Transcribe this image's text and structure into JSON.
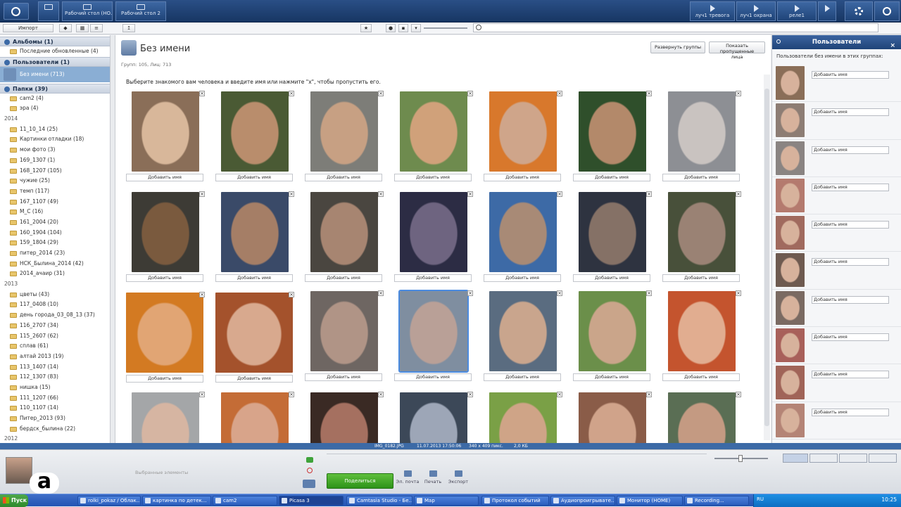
{
  "topbar": {
    "desktop1": "Рабочий стол (НО...",
    "desktop2": "Рабочий стол 2",
    "right_buttons": [
      "луч1 тревога",
      "луч1 охрана",
      "реле1"
    ]
  },
  "toolbar": {
    "import_label": "Импорт"
  },
  "sidebar": {
    "albums": "Альбомы (1)",
    "recent": "Последние обновленные (4)",
    "people": "Пользователи (1)",
    "noname": "Без имени (713)",
    "folders": "Папки (39)",
    "top_folders": [
      "cam2 (4)",
      "эра (4)"
    ],
    "year_2014": "2014",
    "folders_2014": [
      "11_10_14 (25)",
      "Картинки отладки (18)",
      "мои фото (3)",
      "169_1307 (1)",
      "168_1207 (105)",
      "чужие (25)",
      "темп (117)",
      "167_1107 (49)",
      "М_С (16)",
      "161_2004 (20)",
      "160_1904 (104)",
      "159_1804 (29)",
      "питер_2014 (23)",
      "НСК_Былина_2014 (42)",
      "2014_ачаир (31)"
    ],
    "year_2013": "2013",
    "folders_2013": [
      "цветы (43)",
      "117_0408 (10)",
      "день города_03_08_13 (37)",
      "116_2707 (34)",
      "115_2607 (62)",
      "сплав (61)",
      "алтай 2013 (19)",
      "113_1407 (14)",
      "112_1307 (83)",
      "нишка (15)",
      "111_1207 (66)",
      "110_1107 (14)",
      "Питер_2013 (93)",
      "бердск_былина (22)"
    ],
    "year_2012": "2012"
  },
  "main": {
    "title": "Без имени",
    "stats": "Групп: 105, Лиц: 713",
    "expand_button": "Развернуть группы",
    "show_skipped_line1": "Показать пропущенные",
    "show_skipped_line2": "лица",
    "instruction": "Выберите знакомого вам человека и введите имя или нажмите \"x\", чтобы пропустить его.",
    "add_name": "Добавить имя",
    "close_glyph": "×"
  },
  "faces": [
    {
      "c1": "#d8b79a",
      "c2": "#8a6e58"
    },
    {
      "c1": "#b98d6c",
      "c2": "#4a5a34"
    },
    {
      "c1": "#c7a083",
      "c2": "#7d7d78"
    },
    {
      "c1": "#d0a17a",
      "c2": "#6e8b4e"
    },
    {
      "c1": "#cfa58a",
      "c2": "#d8782c"
    },
    {
      "c1": "#b3896a",
      "c2": "#2f4f2b"
    },
    {
      "c1": "#c9c3c0",
      "c2": "#8d8f94"
    },
    {
      "c1": "#7a5a3e",
      "c2": "#3d3b35"
    },
    {
      "c1": "#a57e66",
      "c2": "#3a4a68"
    },
    {
      "c1": "#a78571",
      "c2": "#4a4640"
    },
    {
      "c1": "#6e6480",
      "c2": "#2c2c44"
    },
    {
      "c1": "#a88a76",
      "c2": "#3d6aa6"
    },
    {
      "c1": "#857166",
      "c2": "#2e3340"
    },
    {
      "c1": "#9a8274",
      "c2": "#48503a"
    },
    {
      "c1": "#e1a574",
      "c2": "#d37a22"
    },
    {
      "c1": "#d8a98e",
      "c2": "#a4522c"
    },
    {
      "c1": "#b09486",
      "c2": "#6e6662"
    },
    {
      "c1": "#b9a097",
      "c2": "#7f8ea0"
    },
    {
      "c1": "#c9a58d",
      "c2": "#5a6c80"
    },
    {
      "c1": "#caa58a",
      "c2": "#6b8f4a"
    },
    {
      "c1": "#e1ad90",
      "c2": "#c4542e"
    },
    {
      "c1": "#d6b5a2",
      "c2": "#a4a6a8"
    },
    {
      "c1": "#d8a48a",
      "c2": "#c46c36"
    },
    {
      "c1": "#a57060",
      "c2": "#3a2a24"
    },
    {
      "c1": "#9da6b7",
      "c2": "#3c4858"
    },
    {
      "c1": "#cfa487",
      "c2": "#7aa046"
    },
    {
      "c1": "#d0a38a",
      "c2": "#8a5c48"
    },
    {
      "c1": "#c49a82",
      "c2": "#5a6e54"
    }
  ],
  "rpanel": {
    "title": "Пользователи",
    "subtitle": "Пользователи без имени в этих группах:",
    "add_name": "Добавить имя",
    "thumbs": [
      "#8a6e58",
      "#8d7d74",
      "#8a8482",
      "#b47a6e",
      "#a06a5e",
      "#6e5a50",
      "#7a6a62",
      "#a8605a",
      "#a06458",
      "#b48476"
    ]
  },
  "status": {
    "file": "IMG_0182.JPG",
    "date": "11.07.2013 17:50:06",
    "size": "340 x 409 пикс.",
    "mb": "2,0 КБ"
  },
  "tray": {
    "selected": "Выбранные элементы",
    "share": "Поделиться",
    "email": "Эл. почта",
    "print": "Печать",
    "export": "Экспорт"
  },
  "taskbar": {
    "start": "Пуск",
    "items": [
      "rolki_pokaz / Облак...",
      "картинка по детек...",
      "cam2",
      "Picasa 3",
      "Camtasia Studio - Бе...",
      "Мар",
      "Протокол событий",
      "Аудиопроигрывате...",
      "Монитор (HOME)",
      "Recording..."
    ],
    "lang": "RU",
    "clock": "10:25"
  },
  "colors": {
    "accent": "#2a4f86",
    "selection": "#4b8be0",
    "share": "#2d9319"
  }
}
